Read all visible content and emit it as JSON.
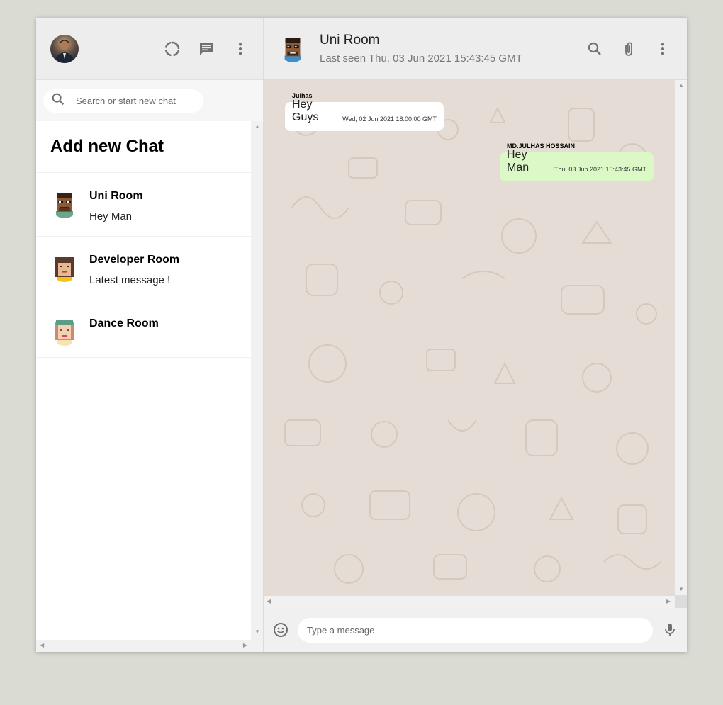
{
  "sidebar": {
    "search_placeholder": "Search or start new chat",
    "add_chat_label": "Add new Chat",
    "rooms": [
      {
        "name": "Uni Room",
        "last_message": "Hey Man"
      },
      {
        "name": "Developer Room",
        "last_message": "Latest message !"
      },
      {
        "name": "Dance Room",
        "last_message": ""
      }
    ]
  },
  "header": {
    "room_name": "Uni Room",
    "last_seen": "Last seen Thu, 03 Jun 2021 15:43:45 GMT"
  },
  "messages": [
    {
      "sender": "Julhas",
      "text": "Hey Guys",
      "time": "Wed, 02 Jun 2021 18:00:00 GMT",
      "type": "received"
    },
    {
      "sender": "MD.JULHAS HOSSAIN",
      "text": "Hey Man",
      "time": "Thu, 03 Jun 2021 15:43:45 GMT",
      "type": "sent"
    }
  ],
  "footer": {
    "input_placeholder": "Type a message"
  },
  "colors": {
    "page_bg": "#dadbd3",
    "panel_bg": "#ededed",
    "chat_bg": "#e5ddd5",
    "sent_bubble": "#dcf8c6",
    "received_bubble": "#ffffff",
    "icon": "#6f6f6f"
  },
  "icons": {
    "status": "status-ring-icon",
    "new_chat": "message-icon",
    "menu": "more-vert-icon",
    "search": "search-icon",
    "attach": "attach-icon",
    "emoji": "emoji-icon",
    "mic": "mic-icon"
  }
}
